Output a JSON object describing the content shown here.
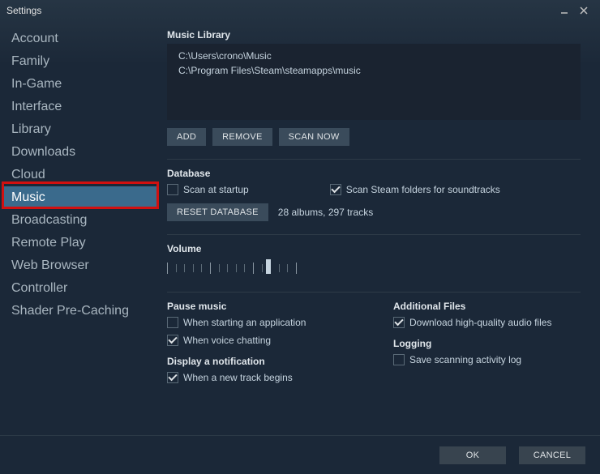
{
  "window": {
    "title": "Settings"
  },
  "sidebar": {
    "items": [
      {
        "label": "Account"
      },
      {
        "label": "Family"
      },
      {
        "label": "In-Game"
      },
      {
        "label": "Interface"
      },
      {
        "label": "Library"
      },
      {
        "label": "Downloads"
      },
      {
        "label": "Cloud"
      },
      {
        "label": "Music",
        "active": true,
        "highlighted": true
      },
      {
        "label": "Broadcasting"
      },
      {
        "label": "Remote Play"
      },
      {
        "label": "Web Browser"
      },
      {
        "label": "Controller"
      },
      {
        "label": "Shader Pre-Caching"
      }
    ]
  },
  "music": {
    "library_heading": "Music Library",
    "library_paths": [
      "C:\\Users\\crono\\Music",
      "C:\\Program Files\\Steam\\steamapps\\music"
    ],
    "buttons": {
      "add": "ADD",
      "remove": "REMOVE",
      "scan_now": "SCAN NOW",
      "reset_db": "RESET DATABASE"
    },
    "database_heading": "Database",
    "scan_startup": {
      "label": "Scan at startup",
      "checked": false
    },
    "scan_soundtracks": {
      "label": "Scan Steam folders for soundtracks",
      "checked": true
    },
    "db_status": "28 albums, 297 tracks",
    "volume_heading": "Volume",
    "volume": {
      "value": 80,
      "min": 0,
      "max": 100
    },
    "pause_heading": "Pause music",
    "pause_app": {
      "label": "When starting an application",
      "checked": false
    },
    "pause_voice": {
      "label": "When voice chatting",
      "checked": true
    },
    "notify_heading": "Display a notification",
    "notify_track": {
      "label": "When a new track begins",
      "checked": true
    },
    "additional_heading": "Additional Files",
    "download_hq": {
      "label": "Download high-quality audio files",
      "checked": true
    },
    "logging_heading": "Logging",
    "save_log": {
      "label": "Save scanning activity log",
      "checked": false
    }
  },
  "footer": {
    "ok": "OK",
    "cancel": "CANCEL"
  }
}
